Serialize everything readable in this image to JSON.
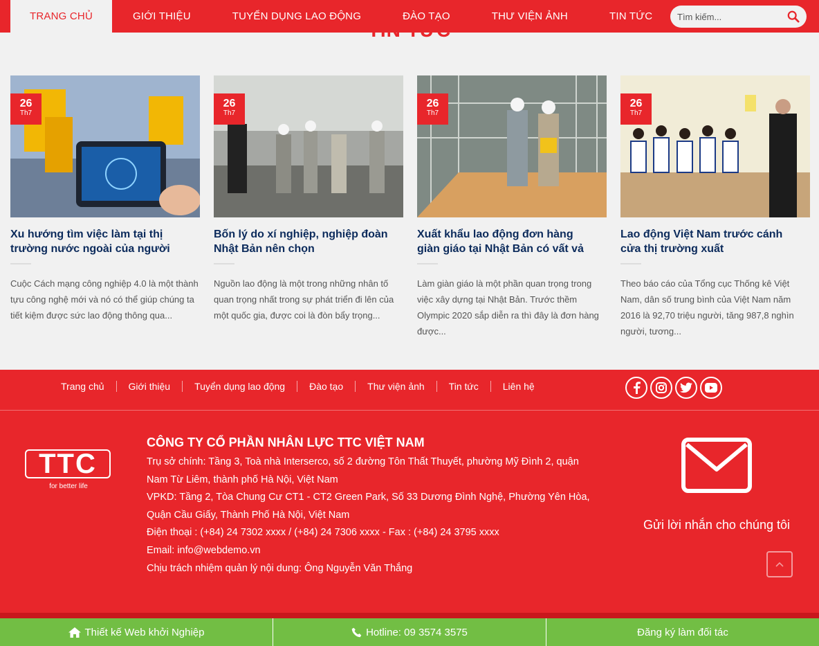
{
  "nav": {
    "items": [
      "TRANG CHỦ",
      "GIỚI THIỆU",
      "TUYỂN DỤNG LAO ĐỘNG",
      "ĐÀO TẠO",
      "THƯ VIỆN ẢNH",
      "TIN TỨC"
    ],
    "search_placeholder": "Tìm kiếm..."
  },
  "section": {
    "title": "TIN TỨC"
  },
  "posts": [
    {
      "day": "26",
      "month": "Th7",
      "title": "Xu hướng tìm việc làm tại thị trường nước ngoài của người lao",
      "excerpt": "Cuộc Cách mạng công nghiệp 4.0 là một thành tựu công nghệ mới và nó có thể giúp chúng ta tiết kiệm được sức lao động thông qua..."
    },
    {
      "day": "26",
      "month": "Th7",
      "title": "Bốn lý do xí nghiệp, nghiệp đoàn Nhật Bản nên chọn",
      "excerpt": "Nguồn lao động là một trong những nhân tố quan trọng nhất trong sự phát triển đi lên của một quốc gia, được coi là đòn bẩy trọng..."
    },
    {
      "day": "26",
      "month": "Th7",
      "title": "Xuất khẩu lao động đơn hàng giàn giáo tại Nhật Bản có vất vả không?",
      "excerpt": "Làm giàn giáo là một phần quan trọng trong việc xây dựng tại Nhật Bản. Trước thềm Olympic 2020 sắp diễn ra thì đây là đơn hàng được..."
    },
    {
      "day": "26",
      "month": "Th7",
      "title": "Lao động Việt Nam trước cánh cửa thị trường xuất",
      "excerpt": "Theo báo cáo của Tổng cục Thống kê Việt Nam, dân số trung bình của Việt Nam năm 2016 là 92,70 triệu người, tăng 987,8 nghìn người, tương..."
    }
  ],
  "footer": {
    "links": [
      "Trang chủ",
      "Giới thiệu",
      "Tuyển dụng lao động",
      "Đào tạo",
      "Thư viện ảnh",
      "Tin tức",
      "Liên hệ"
    ],
    "socials": [
      "facebook-icon",
      "instagram-icon",
      "twitter-icon",
      "youtube-icon"
    ],
    "logo_text": "TTC",
    "logo_tagline": "for better life",
    "company_name": "CÔNG TY CỔ PHẦN NHÂN LỰC TTC VIỆT NAM",
    "address_main": "Trụ sở chính: Tầng 3, Toà nhà Interserco, số 2 đường Tôn Thất Thuyết, phường Mỹ Đình 2, quận Nam Từ Liêm, thành phố Hà Nội, Việt Nam",
    "address_office": "VPKD: Tầng 2, Tòa Chung Cư CT1 - CT2 Green Park, Số 33 Dương Đình Nghệ, Phường Yên Hòa, Quận Cầu Giấy, Thành Phố Hà Nội, Việt Nam",
    "phone": "Điện thoại : (+84) 24 7302 xxxx / (+84) 24 7306 xxxx - Fax : (+84) 24 3795 xxxx",
    "email": "Email: info@webdemo.vn",
    "responsible": "Chịu trách nhiệm quản lý nội dung: Ông Nguyễn Văn Thắng",
    "contact_cta": "Gửi lời nhắn cho chúng tôi"
  },
  "cta_bar": {
    "design": "Thiết kế Web khởi Nghiệp",
    "hotline": "Hotline: 09 3574 3575",
    "partner": "Đăng ký làm đối tác"
  },
  "colors": {
    "brand_red": "#e8262b",
    "navy": "#0b2a5b",
    "cta_green": "#72be44"
  }
}
